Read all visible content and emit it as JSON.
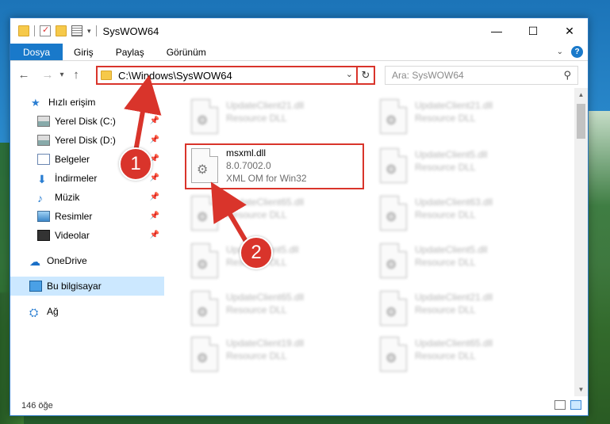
{
  "window": {
    "title": "SysWOW64",
    "controls": [
      "—",
      "☐",
      "✕"
    ]
  },
  "ribbon": {
    "tabs": [
      "Dosya",
      "Giriş",
      "Paylaş",
      "Görünüm"
    ],
    "help": "?"
  },
  "nav": {
    "back": "←",
    "forward": "→",
    "recent": "▾",
    "up": "↑",
    "address": "C:\\Windows\\SysWOW64",
    "address_dropdown": "⌄",
    "refresh": "↻",
    "search_placeholder": "Ara: SysWOW64",
    "search_icon": "⚲"
  },
  "sidebar": {
    "items": [
      {
        "label": "Hızlı erişim",
        "icon": "star-icon",
        "glyph": "★",
        "pinned": false
      },
      {
        "label": "Yerel Disk (C:)",
        "icon": "drive-icon",
        "glyph": "",
        "pinned": true
      },
      {
        "label": "Yerel Disk (D:)",
        "icon": "drive-icon",
        "glyph": "",
        "pinned": true
      },
      {
        "label": "Belgeler",
        "icon": "documents-icon",
        "glyph": "",
        "pinned": true
      },
      {
        "label": "İndirmeler",
        "icon": "downloads-icon",
        "glyph": "⬇",
        "pinned": true
      },
      {
        "label": "Müzik",
        "icon": "music-icon",
        "glyph": "♪",
        "pinned": true
      },
      {
        "label": "Resimler",
        "icon": "pictures-icon",
        "glyph": "",
        "pinned": true
      },
      {
        "label": "Videolar",
        "icon": "videos-icon",
        "glyph": "",
        "pinned": true
      },
      {
        "label": "OneDrive",
        "icon": "onedrive-icon",
        "glyph": "☁",
        "pinned": false
      },
      {
        "label": "Bu bilgisayar",
        "icon": "computer-icon",
        "glyph": "",
        "pinned": false
      },
      {
        "label": "Ağ",
        "icon": "network-icon",
        "glyph": "⛭",
        "pinned": false
      }
    ],
    "pin_glyph": "📌"
  },
  "files": {
    "left_column": [
      {
        "name": "UpdateClient21.dll",
        "desc": "Resource DLL"
      },
      {
        "name": "msxml.dll",
        "desc": "8.0.7002.0",
        "desc2": "XML OM for Win32"
      },
      {
        "name": "UpdateClient65.dll",
        "desc": "Resource DLL"
      },
      {
        "name": "UpdateClient5.dll",
        "desc": "Resource DLL"
      },
      {
        "name": "UpdateClient65.dll",
        "desc": "Resource DLL"
      },
      {
        "name": "UpdateClient19.dll",
        "desc": "Resource DLL"
      }
    ],
    "right_column": [
      {
        "name": "UpdateClient21.dll",
        "desc": "Resource DLL"
      },
      {
        "name": "UpdateClient5.dll",
        "desc": "Resource DLL"
      },
      {
        "name": "UpdateClient63.dll",
        "desc": "Resource DLL"
      },
      {
        "name": "UpdateClient5.dll",
        "desc": "Resource DLL"
      },
      {
        "name": "UpdateClient21.dll",
        "desc": "Resource DLL"
      },
      {
        "name": "UpdateClient65.dll",
        "desc": "Resource DLL"
      }
    ]
  },
  "status": {
    "count": "146 öğe"
  },
  "annotations": {
    "step1": "1",
    "step2": "2",
    "color": "#d9342b"
  }
}
